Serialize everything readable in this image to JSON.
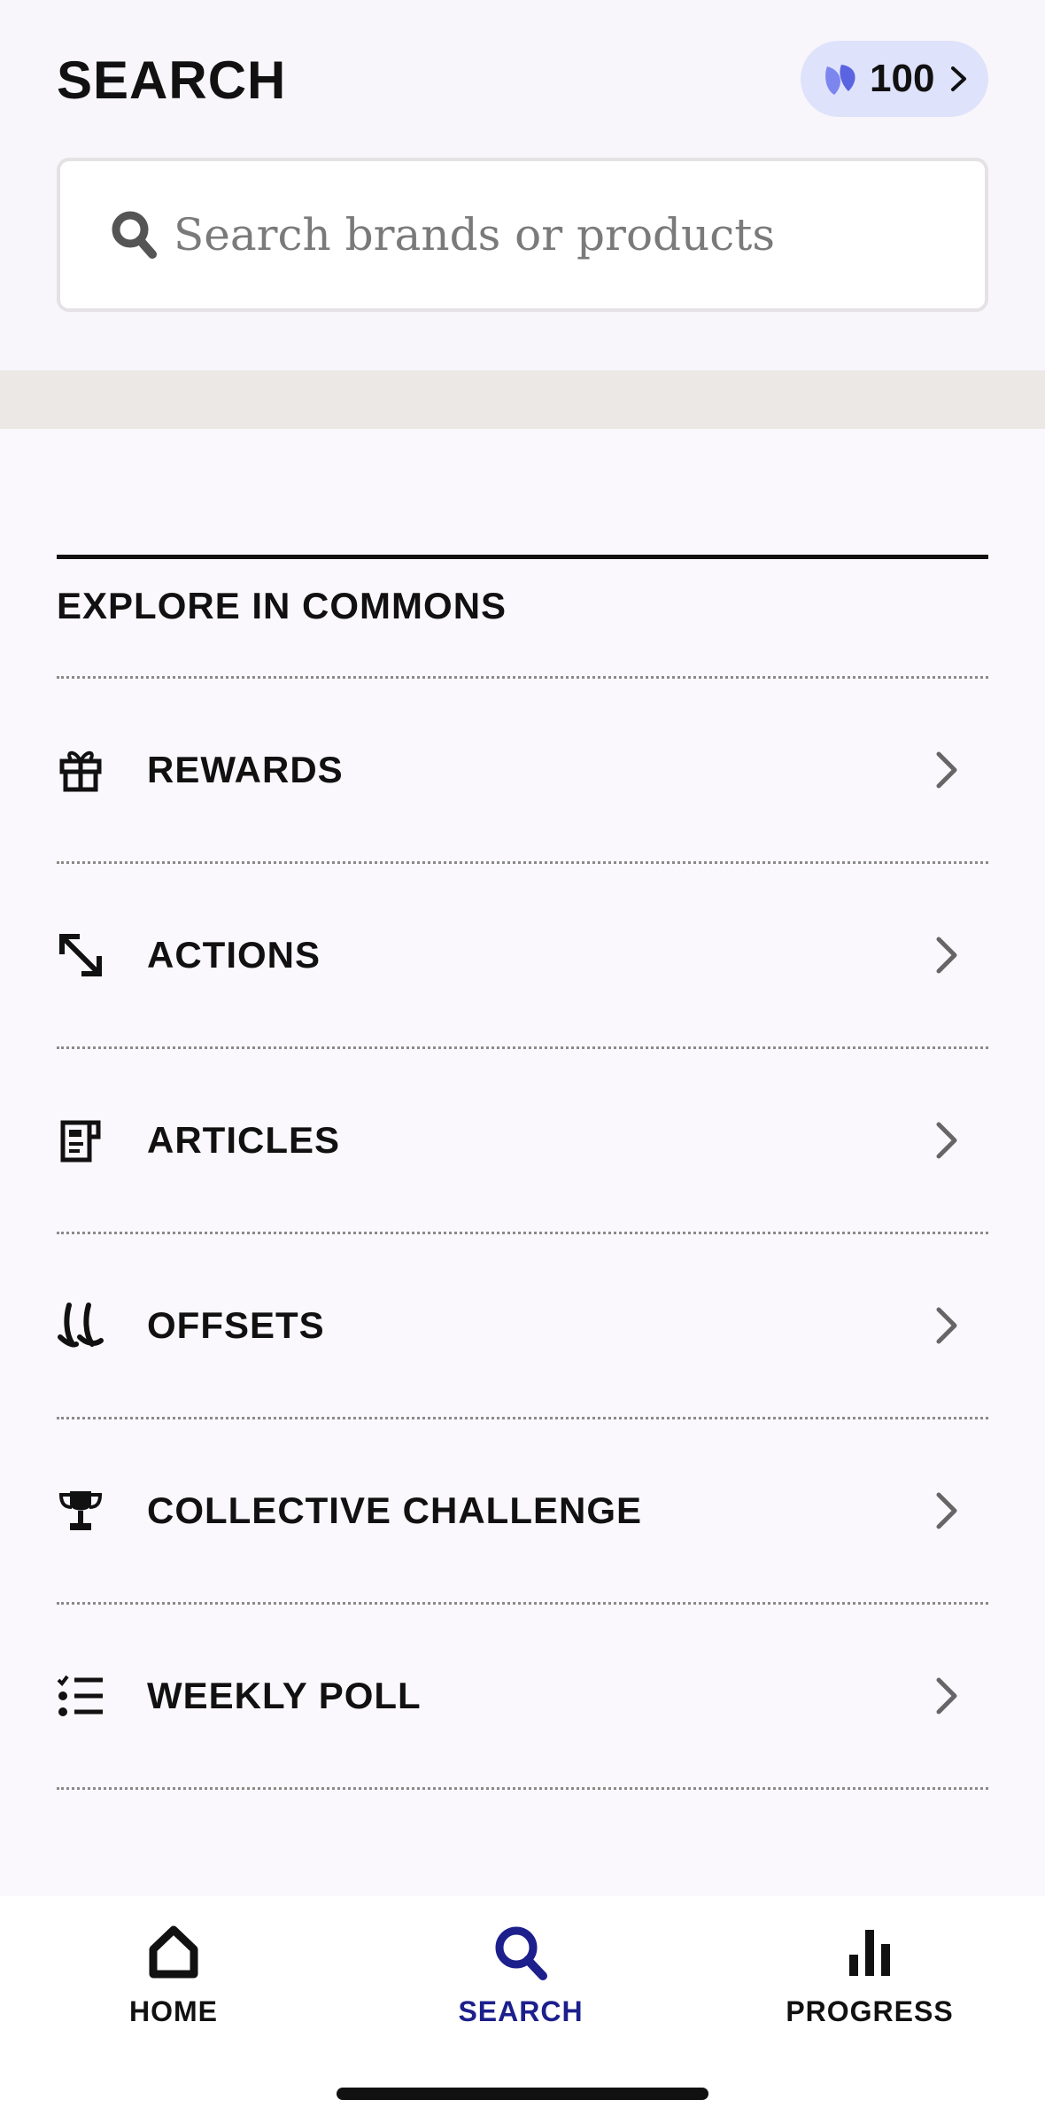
{
  "header": {
    "title": "SEARCH",
    "points": {
      "value": "100",
      "icon": "leaf-icon",
      "accent": "#dfe2fb"
    }
  },
  "search": {
    "placeholder": "Search brands or products",
    "value": ""
  },
  "explore": {
    "title": "EXPLORE IN COMMONS",
    "items": [
      {
        "label": "REWARDS",
        "icon": "gift-icon"
      },
      {
        "label": "ACTIONS",
        "icon": "arrow-diagonal-icon"
      },
      {
        "label": "ARTICLES",
        "icon": "article-icon"
      },
      {
        "label": "OFFSETS",
        "icon": "sprout-icon"
      },
      {
        "label": "COLLECTIVE CHALLENGE",
        "icon": "trophy-icon"
      },
      {
        "label": "WEEKLY POLL",
        "icon": "checklist-icon"
      }
    ]
  },
  "tabbar": {
    "home": "HOME",
    "search": "SEARCH",
    "progress": "PROGRESS",
    "active": "SEARCH",
    "active_color": "#1c1f8c"
  }
}
